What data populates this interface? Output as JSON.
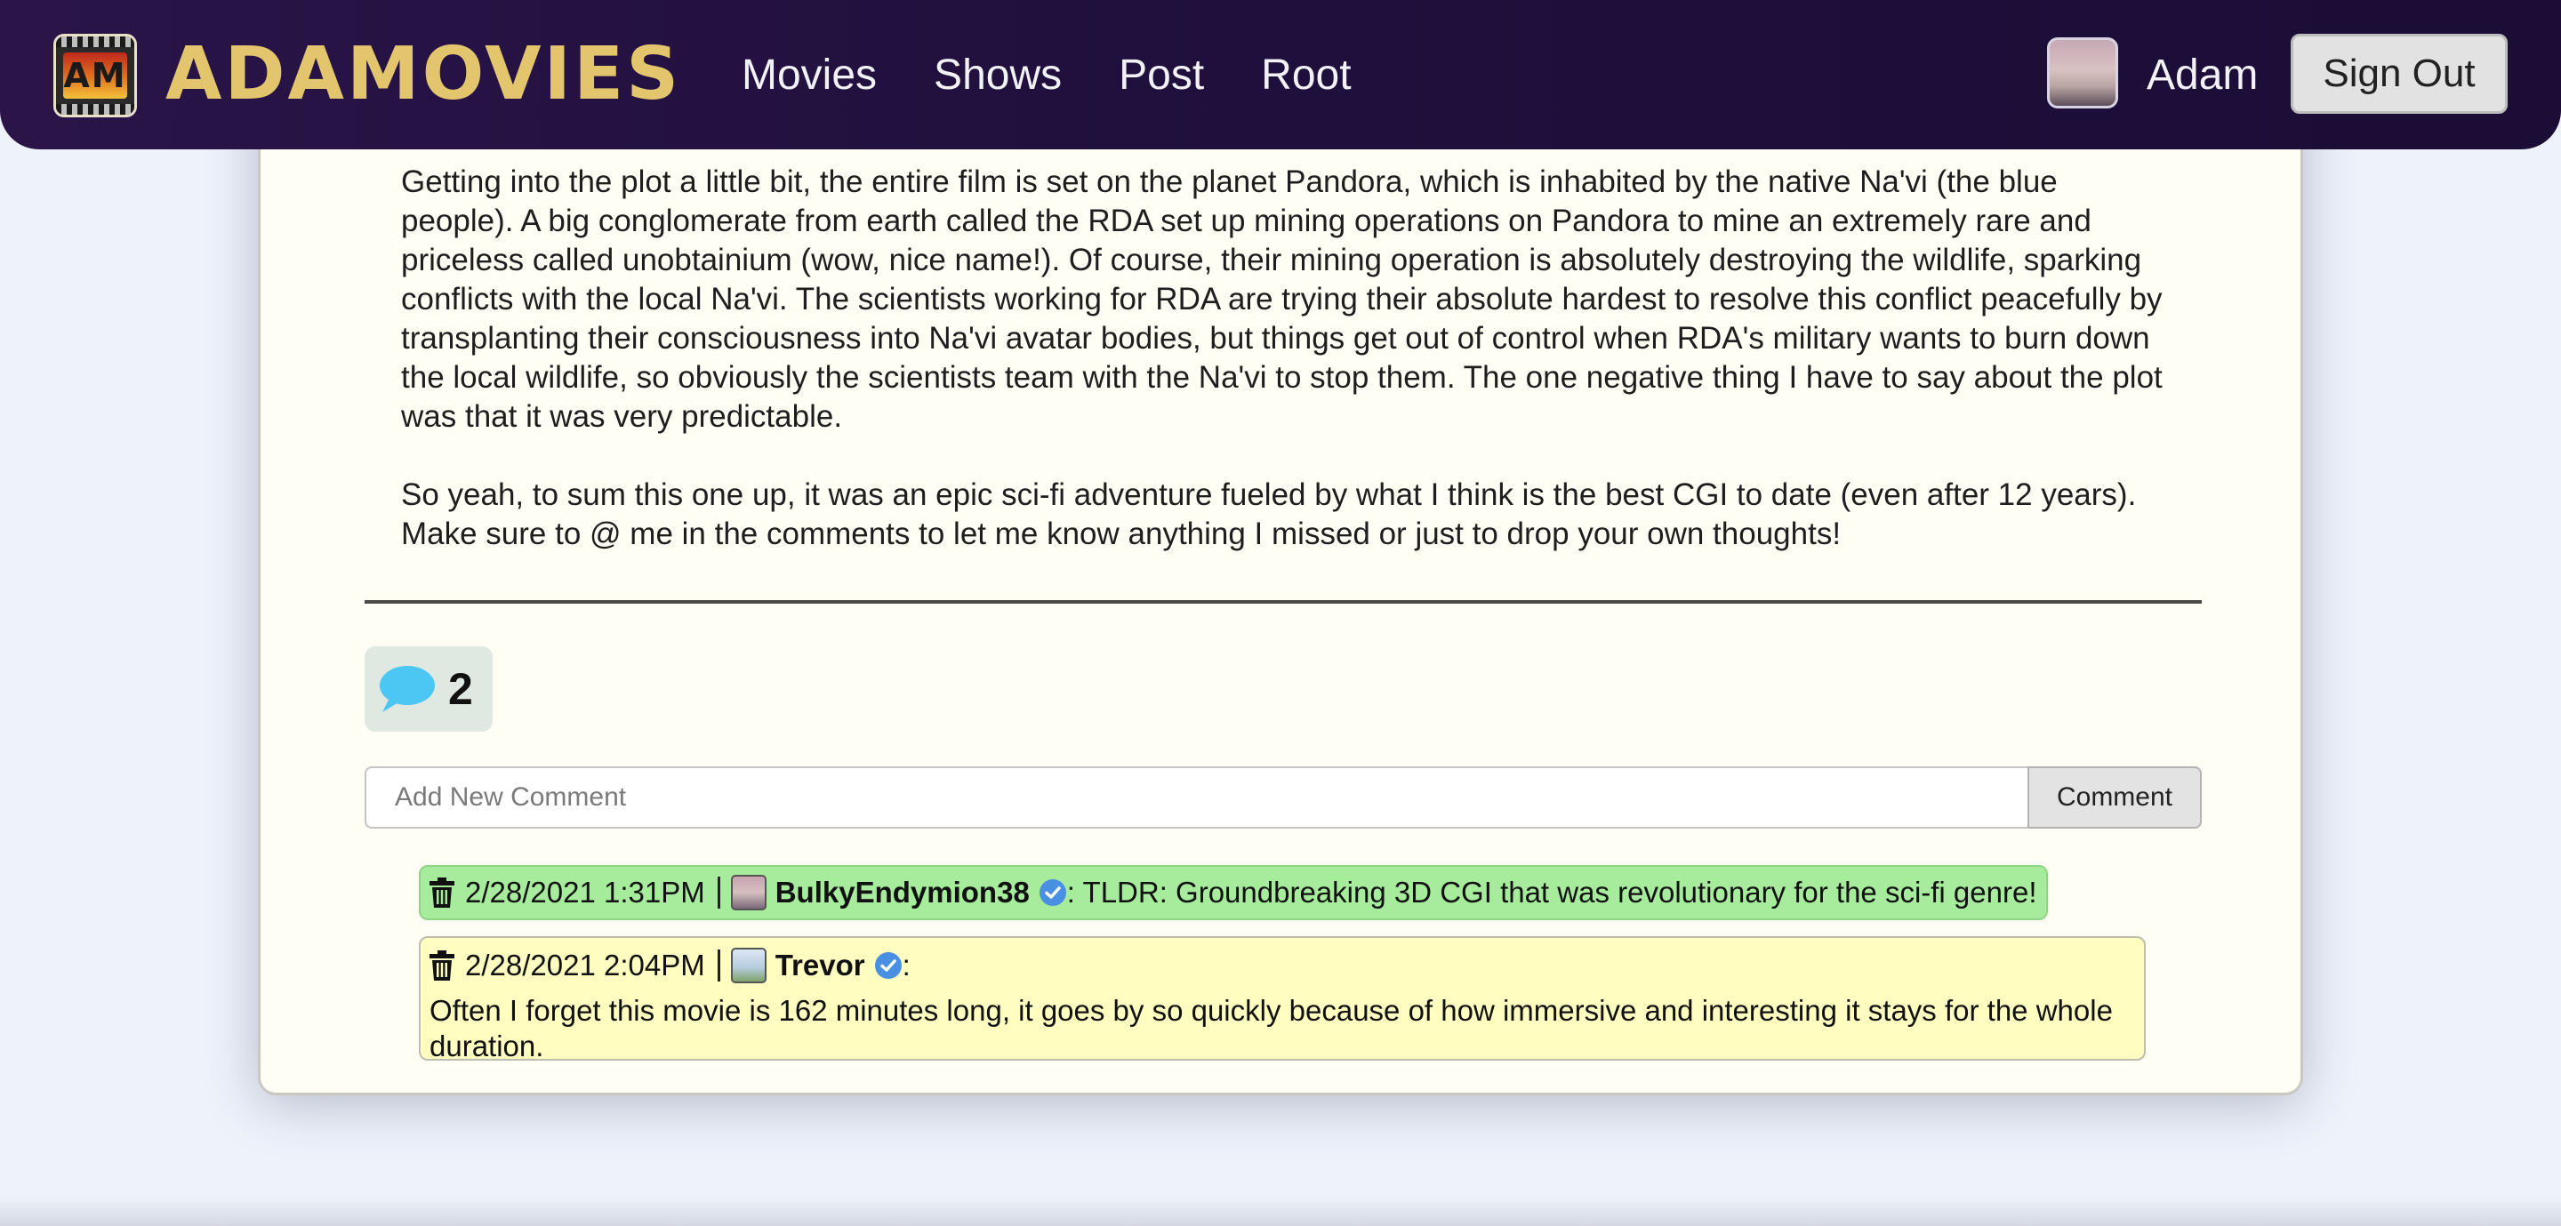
{
  "navbar": {
    "logo_letters": "AM",
    "brand": "ADAMOVIES",
    "links": [
      {
        "label": "Movies"
      },
      {
        "label": "Shows"
      },
      {
        "label": "Post"
      },
      {
        "label": "Root"
      }
    ],
    "user_name": "Adam",
    "sign_out_label": "Sign Out"
  },
  "post": {
    "paragraphs": [
      "Getting into the plot a little bit, the entire film is set on the planet Pandora, which is inhabited by the native Na'vi (the blue people). A big conglomerate from earth called the RDA set up mining operations on Pandora to mine an extremely rare and priceless called unobtainium (wow, nice name!). Of course, their mining operation is absolutely destroying the wildlife, sparking conflicts with the local Na'vi. The scientists working for RDA are trying their absolute hardest to resolve this conflict peacefully by transplanting their consciousness into Na'vi avatar bodies, but things get out of control when RDA's military wants to burn down the local wildlife, so obviously the scientists team with the Na'vi to stop them. The one negative thing I have to say about the plot was that it was very predictable.",
      "So yeah, to sum this one up, it was an epic sci-fi adventure fueled by what I think is the best CGI to date (even after 12 years). Make sure to @ me in the comments to let me know anything I missed or just to drop your own thoughts!"
    ]
  },
  "comments_section": {
    "count": "2",
    "input_placeholder": "Add New Comment",
    "comment_button_label": "Comment",
    "comments": [
      {
        "timestamp": "2/28/2021 1:31PM",
        "user": "BulkyEndymion38",
        "text": ": TLDR: Groundbreaking 3D CGI that was revolutionary for the sci-fi genre!",
        "bg_color": "#a6ec9c"
      },
      {
        "timestamp": "2/28/2021 2:04PM",
        "user": "Trevor",
        "colon": ":",
        "text": "Often I forget this movie is 162 minutes long, it goes by so quickly because of how immersive and interesting it stays for the whole duration.",
        "bg_color": "#fffdc0"
      }
    ]
  },
  "colors": {
    "navbar_bg": "#1f0f3c",
    "brand_gold": "#e3c56e",
    "card_bg": "#fffef4",
    "page_bg": "#eef2fb",
    "chat_icon_blue": "#4cc7f4",
    "verified_blue": "#4a90e2"
  },
  "icons": {
    "comment_count": "chat-bubble-icon",
    "delete": "trash-icon",
    "verified": "verified-badge-icon"
  }
}
